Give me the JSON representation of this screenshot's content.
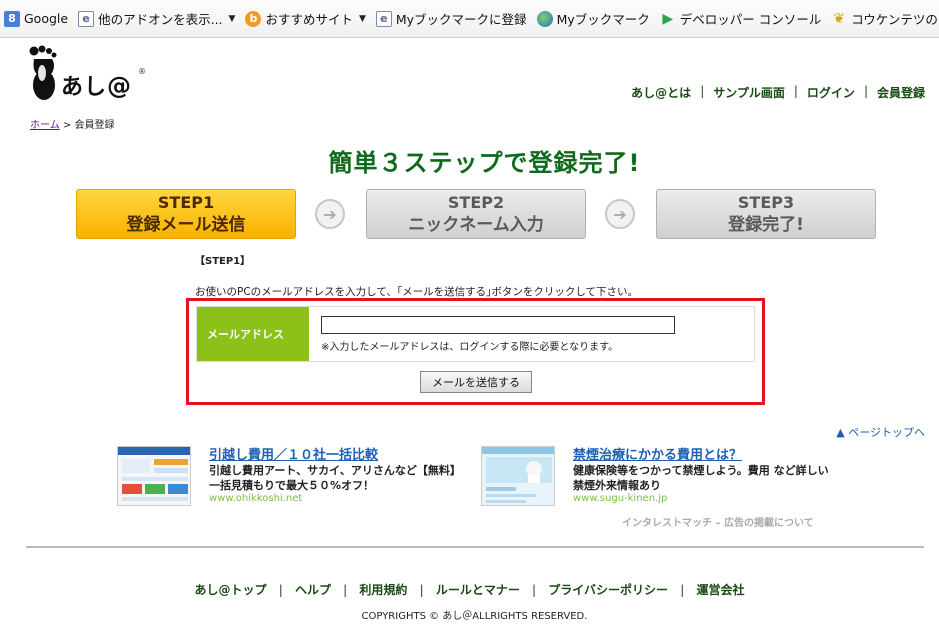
{
  "bookmarks": [
    {
      "label": "Google",
      "icon": "google-icon",
      "glyph": "8"
    },
    {
      "label": "他のアドオンを表示...",
      "icon": "page-icon",
      "glyph": "e",
      "has_dropdown": true
    },
    {
      "label": "おすすめサイト",
      "icon": "bing-icon",
      "glyph": "b",
      "has_dropdown": true
    },
    {
      "label": "Myブックマークに登録",
      "icon": "page-icon",
      "glyph": "e"
    },
    {
      "label": "Myブックマーク",
      "icon": "globe-icon",
      "glyph": ""
    },
    {
      "label": "デベロッパー コンソール",
      "icon": "play-icon",
      "glyph": "▶"
    },
    {
      "label": "コウケンテツの「お",
      "icon": "leaf-icon",
      "glyph": "❦"
    }
  ],
  "logo": {
    "text": "あし",
    "suffix": "@",
    "reg": "®"
  },
  "top_nav": [
    "あし@とは",
    "サンプル画面",
    "ログイン",
    "会員登録"
  ],
  "breadcrumb": {
    "home": "ホーム",
    "separator": " > ",
    "current": "会員登録"
  },
  "headline": "簡単３ステップで登録完了!",
  "steps": [
    {
      "num": "STEP1",
      "title": "登録メール送信",
      "active": true
    },
    {
      "num": "STEP2",
      "title": "ニックネーム入力",
      "active": false
    },
    {
      "num": "STEP3",
      "title": "登録完了!",
      "active": false
    }
  ],
  "step_label": "【STEP1】",
  "instruction": "お使いのPCのメールアドレスを入力して、｢メールを送信する｣ボタンをクリックして下さい。",
  "form": {
    "label": "メールアドレス",
    "value": "",
    "placeholder": "",
    "note": "※入力したメールアドレスは、ログインする際に必要となります。",
    "submit": "メールを送信する"
  },
  "page_top": "▲ ページトップへ",
  "ads": [
    {
      "title": "引越し費用／１０社一括比較",
      "desc": "引越し費用アート、サカイ、アリさんなど【無料】一括見積もりで最大５０%オフ！",
      "url": "www.ohikkoshi.net"
    },
    {
      "title": "禁煙治療にかかる費用とは？",
      "desc": "健康保険等をつかって禁煙しよう。費用 など詳しい禁煙外来情報あり",
      "url": "www.sugu-kinen.jp"
    }
  ],
  "ad_credit": "インタレストマッチ – 広告の掲載について",
  "footer_nav": [
    "あし@トップ",
    "ヘルプ",
    "利用規約",
    "ルールとマナー",
    "プライバシーポリシー",
    "運営会社"
  ],
  "copyright": "COPYRIGHTS © あし＠ALLRIGHTS RESERVED.",
  "colors": {
    "accent_green": "#8cc11a",
    "headline_green": "#0f6a1d",
    "frame_red": "#e0131e",
    "step_active": "#f9b200"
  }
}
